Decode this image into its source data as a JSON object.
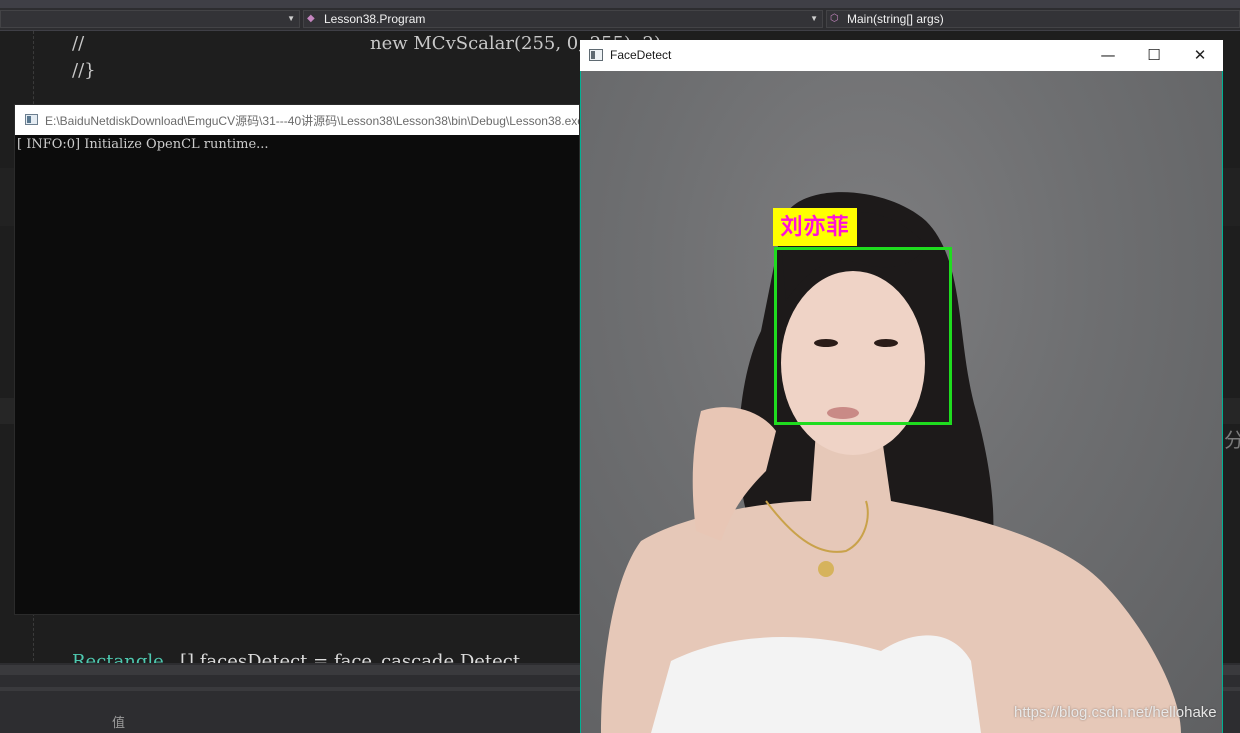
{
  "vs": {
    "nav_combo_1": "Lesson38.Program",
    "nav_combo_2": "Main(string[] args)",
    "code_line_1_comment": "//",
    "code_line_1_rest": "new MCvScalar(255, 0, 255), 2)",
    "code_line_2": "//}",
    "code_bottom_type": "Rectangle",
    "code_bottom_rest": "[] facesDetect = face_cascade.Detect",
    "bottom_label": "值"
  },
  "console": {
    "title": "E:\\BaiduNetdiskDownload\\EmguCV源码\\31---40讲源码\\Lesson38\\Lesson38\\bin\\Debug\\Lesson38.exe",
    "output_line": "[ INFO:0] Initialize OpenCL runtime..."
  },
  "facedetect": {
    "title": "FaceDetect",
    "name_label": "刘亦菲",
    "minimize_icon": "minimize-icon",
    "maximize_icon": "maximize-icon",
    "close_icon": "close-icon"
  },
  "watermark": "https://blog.csdn.net/hellohake",
  "colors": {
    "accent_border": "#00b294",
    "face_box": "#1fdc1f",
    "name_bg": "#ffff00",
    "name_text": "#ff10d8"
  }
}
